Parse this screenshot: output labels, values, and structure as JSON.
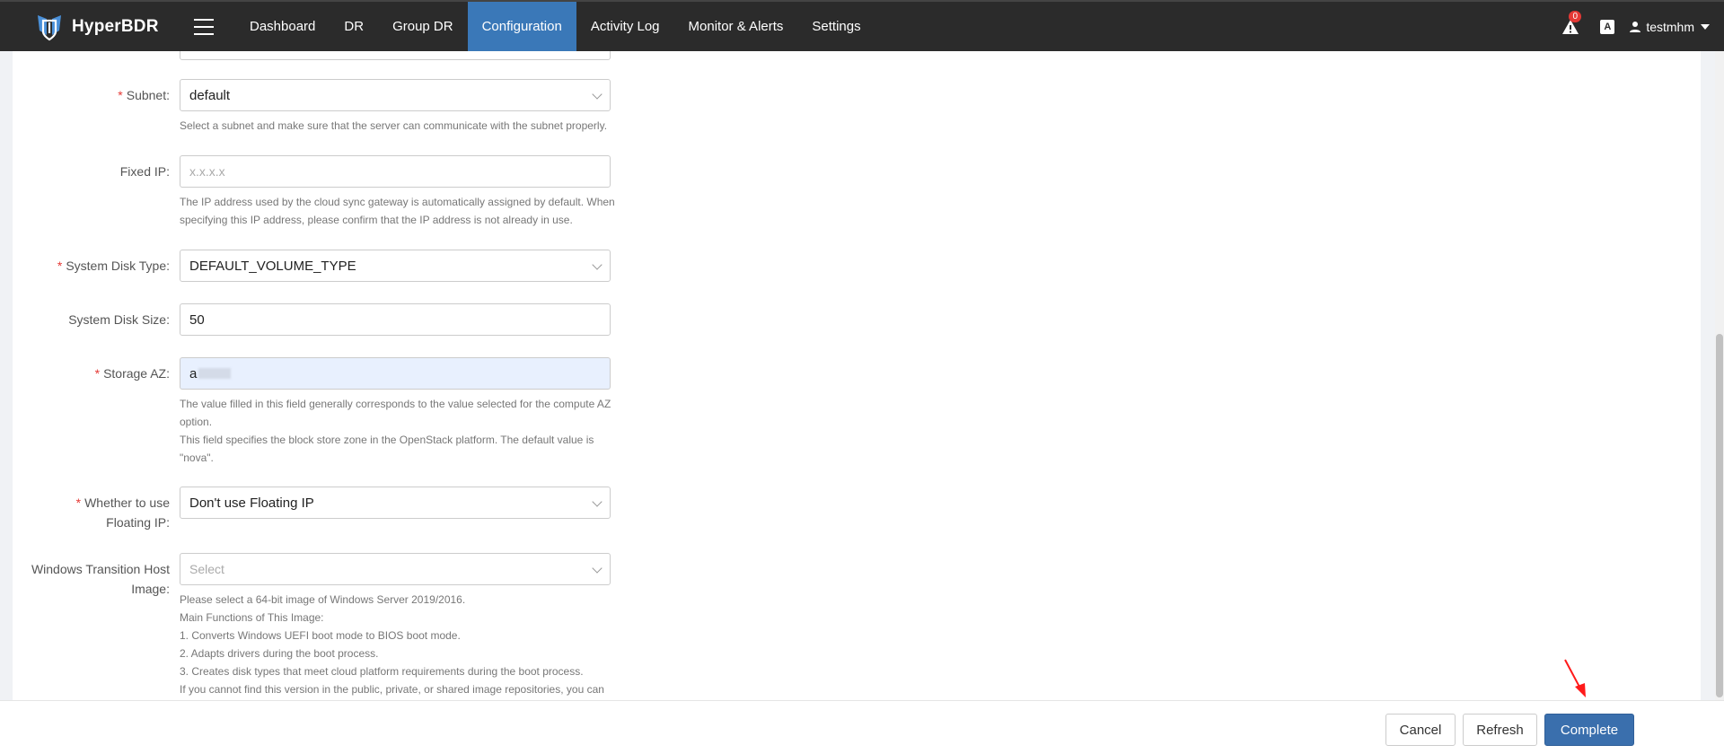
{
  "app": {
    "name": "HyperBDR",
    "alert_count": "0",
    "lang_label": "A",
    "user_name": "testmhm"
  },
  "nav": [
    {
      "label": "Dashboard"
    },
    {
      "label": "DR"
    },
    {
      "label": "Group DR"
    },
    {
      "label": "Configuration"
    },
    {
      "label": "Activity Log"
    },
    {
      "label": "Monitor & Alerts"
    },
    {
      "label": "Settings"
    }
  ],
  "nav_active": "Configuration",
  "form": {
    "required_mark": "*",
    "subnet": {
      "label": "Subnet:",
      "value": "default",
      "help": "Select a subnet and make sure that the server can communicate with the subnet properly."
    },
    "fixed_ip": {
      "label": "Fixed IP:",
      "placeholder": "x.x.x.x",
      "help": "The IP address used by the cloud sync gateway is automatically assigned by default. When specifying this IP address, please confirm that the IP address is not already in use."
    },
    "system_disk_type": {
      "label": "System Disk Type:",
      "value": "DEFAULT_VOLUME_TYPE"
    },
    "system_disk_size": {
      "label": "System Disk Size:",
      "value": "50"
    },
    "storage_az": {
      "label": "Storage AZ:",
      "value": "a",
      "help_1": "The value filled in this field generally corresponds to the value selected for the compute AZ option.",
      "help_2": "This field specifies the block store zone in the OpenStack platform. The default value is \"nova\"."
    },
    "floating_ip": {
      "label_1": "Whether to use",
      "label_2": "Floating IP:",
      "value": "Don't use Floating IP"
    },
    "windows_image": {
      "label_1": "Windows Transition Host",
      "label_2": "Image:",
      "placeholder": "Select",
      "help_lines": [
        "Please select a 64-bit image of Windows Server 2019/2016.",
        "Main Functions of This Image:",
        "1. Converts Windows UEFI boot mode to BIOS boot mode.",
        "2. Adapts drivers during the boot process.",
        "3. Creates disk types that meet cloud platform requirements during the boot process.",
        "If you cannot find this version in the public, private, or shared image repositories, you can"
      ]
    }
  },
  "footer": {
    "cancel": "Cancel",
    "refresh": "Refresh",
    "complete": "Complete"
  },
  "colors": {
    "topbar": "#2b2b2b",
    "accent": "#3a78b8",
    "primary_button": "#3a6fad",
    "required": "#e53935",
    "annotation_arrow": "#ff1a1a"
  }
}
